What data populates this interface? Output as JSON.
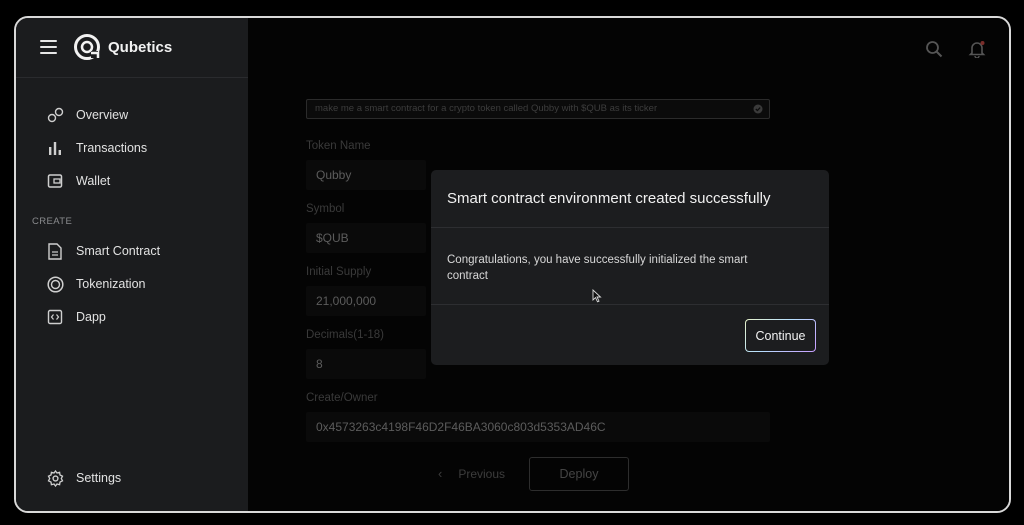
{
  "app": {
    "name": "Qubetics"
  },
  "sidebar": {
    "items": [
      {
        "label": "Overview",
        "icon": "overview-icon"
      },
      {
        "label": "Transactions",
        "icon": "bar-chart-icon"
      },
      {
        "label": "Wallet",
        "icon": "wallet-icon"
      }
    ],
    "create_section_label": "CREATE",
    "create_items": [
      {
        "label": "Smart Contract",
        "icon": "document-icon"
      },
      {
        "label": "Tokenization",
        "icon": "token-icon"
      },
      {
        "label": "Dapp",
        "icon": "code-icon"
      }
    ],
    "settings_label": "Settings"
  },
  "header": {
    "search_icon": "search-icon",
    "notification_icon": "bell-icon",
    "notification_dot_color": "#e0554f"
  },
  "form": {
    "prompt_text": "make me a smart contract for a crypto token called Qubby with $QUB as its ticker",
    "fields": [
      {
        "label": "Token Name",
        "value": "Qubby"
      },
      {
        "label": "Symbol",
        "value": "$QUB"
      },
      {
        "label": "Initial Supply",
        "value": "21,000,000"
      },
      {
        "label": "Decimals(1-18)",
        "value": "8"
      },
      {
        "label": "Create/Owner",
        "value": "0x4573263c4198F46D2F46BA3060c803d5353AD46C"
      }
    ],
    "previous_label": "Previous",
    "deploy_label": "Deploy"
  },
  "modal": {
    "title": "Smart contract environment created successfully",
    "body": "Congratulations, you have successfully initialized the smart contract",
    "continue_label": "Continue"
  }
}
